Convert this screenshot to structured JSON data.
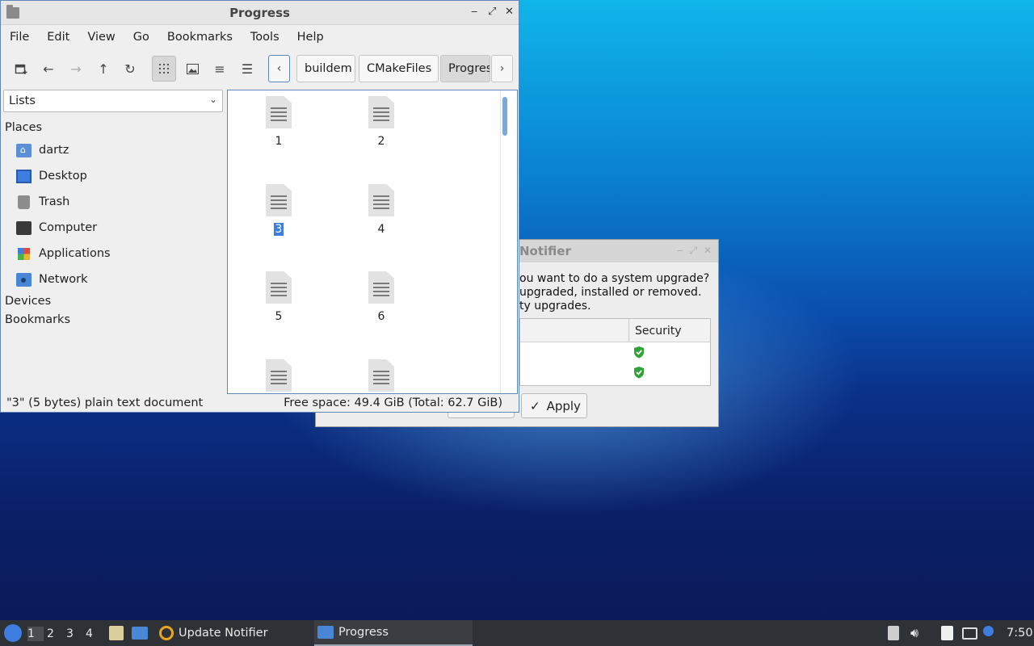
{
  "file_manager": {
    "title": "Progress",
    "menu": [
      "File",
      "Edit",
      "View",
      "Go",
      "Bookmarks",
      "Tools",
      "Help"
    ],
    "breadcrumb": [
      "buildem",
      "CMakeFiles",
      "Progres"
    ],
    "side_panel_mode": "Lists",
    "sections": {
      "places": "Places",
      "devices": "Devices",
      "bookmarks": "Bookmarks"
    },
    "places": [
      {
        "label": "dartz",
        "icon": "home-folder-icon"
      },
      {
        "label": "Desktop",
        "icon": "desktop-icon"
      },
      {
        "label": "Trash",
        "icon": "trash-icon"
      },
      {
        "label": "Computer",
        "icon": "computer-icon"
      },
      {
        "label": "Applications",
        "icon": "applications-icon"
      },
      {
        "label": "Network",
        "icon": "network-icon"
      }
    ],
    "files": [
      "1",
      "2",
      "3",
      "4",
      "5",
      "6",
      "",
      ""
    ],
    "selected_file": "3",
    "status_left": "\"3\" (5 bytes) plain text document",
    "status_right": "Free space: 49.4 GiB (Total: 62.7 GiB)"
  },
  "notifier": {
    "title": "Notifier",
    "message_lines": [
      "ou want to do a system upgrade?",
      "upgraded, installed or removed.",
      "ty upgrades."
    ],
    "column": "Security",
    "apply_label": "Apply"
  },
  "taskbar": {
    "desktops": [
      "1",
      "2",
      "3",
      "4"
    ],
    "active_desktop": "1",
    "tasks": [
      {
        "label": "Update Notifier",
        "icon": "update-notifier-icon"
      },
      {
        "label": "Progress",
        "icon": "folder-icon"
      }
    ],
    "clock": "7:50"
  }
}
